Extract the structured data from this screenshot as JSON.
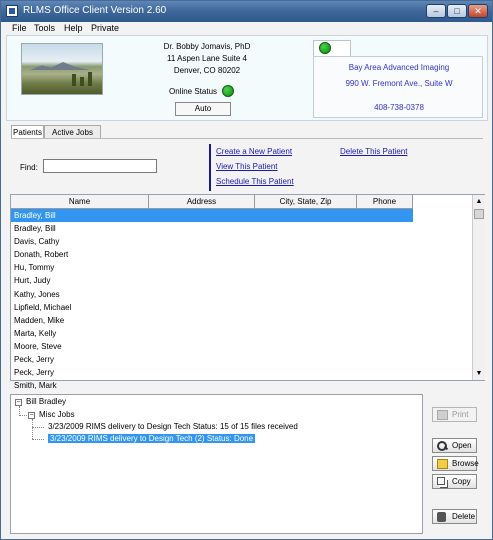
{
  "window": {
    "title": "RLMS Office Client Version 2.60",
    "controls": {
      "minimize": "–",
      "maximize": "□",
      "close": "✕"
    }
  },
  "menu": [
    "File",
    "Tools",
    "Help",
    "Private"
  ],
  "doctor": {
    "name": "Dr. Bobby Jomavis, PhD",
    "address1": "11 Aspen Lane Suite 4",
    "city_line": "Denver, CO  80202",
    "online_status_label": "Online Status",
    "online_status_color": "#1aa61a",
    "auto_button": "Auto"
  },
  "vendor": {
    "name": "Bay Area Advanced Imaging",
    "address": "990 W. Fremont Ave., Suite W",
    "phone": "408-738-0378",
    "status_color": "#1aa61a"
  },
  "tabs": [
    "Patients",
    "Active Jobs"
  ],
  "find": {
    "label": "Find:",
    "value": ""
  },
  "actions": {
    "create": "Create a New Patient",
    "view": "View This Patient",
    "schedule": "Schedule This Patient",
    "delete": "Delete This Patient"
  },
  "grid": {
    "columns": [
      "Name",
      "Address",
      "City, State, Zip",
      "Phone"
    ],
    "rows": [
      "Bradley, Bill",
      "Bradley, Bill",
      "Davis, Cathy",
      "Donath, Robert",
      "Hu, Tommy",
      "Hurt, Judy",
      "Kathy, Jones",
      "Lipfield, Michael",
      "Madden, Mike",
      "Marta, Kelly",
      "Moore, Steve",
      "Peck, Jerry",
      "Peck, Jerry",
      "Smith, Mark"
    ],
    "selected_index": 0
  },
  "tree": {
    "root": "Bill Bradley",
    "group": "Misc Jobs",
    "jobs": [
      "3/23/2009  RIMS delivery to Design Tech   Status: 15 of 15 files received",
      "3/23/2009  RIMS delivery to Design Tech (2)   Status: Done"
    ],
    "selected_job": 1
  },
  "side_buttons": {
    "print": "Print",
    "open": "Open",
    "browse": "Browse",
    "copy": "Copy",
    "delete": "Delete"
  }
}
